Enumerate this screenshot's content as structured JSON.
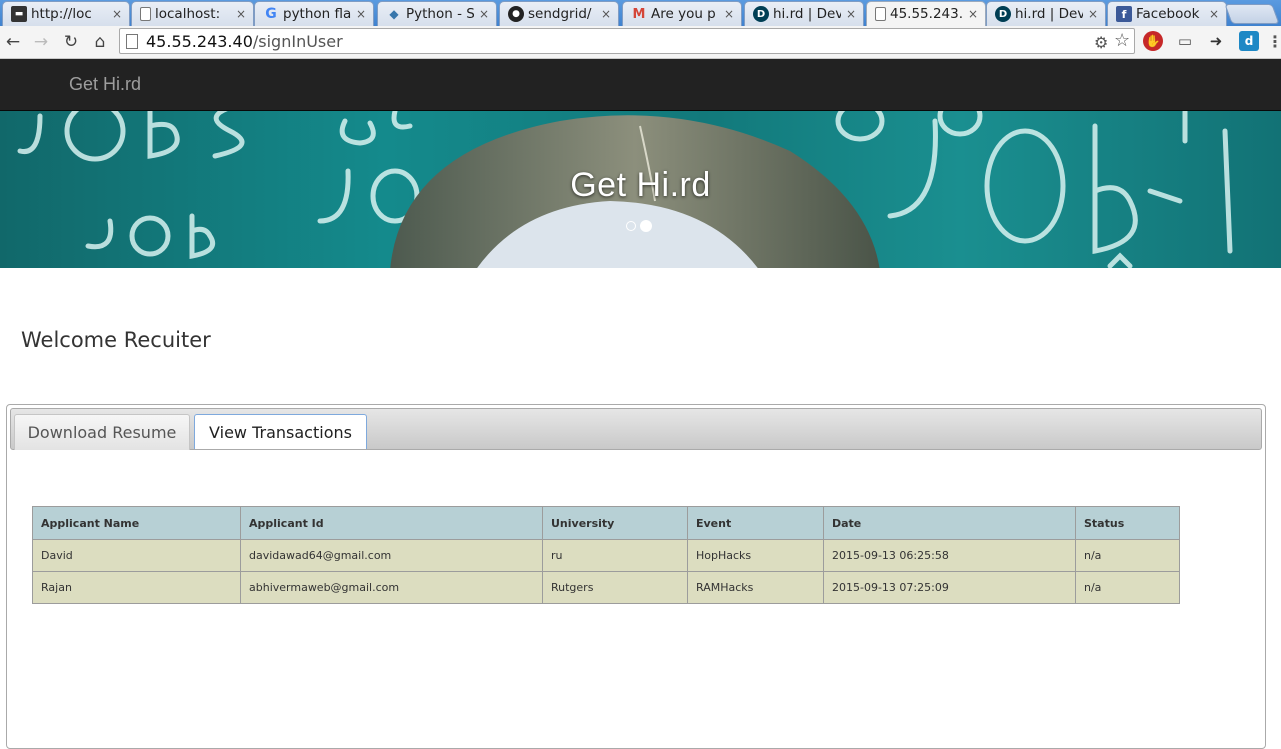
{
  "browser": {
    "tabs": [
      {
        "title": "http://loc",
        "icon": "terminal-icon"
      },
      {
        "title": "localhost:",
        "icon": "page-icon"
      },
      {
        "title": "python fla",
        "icon": "google-icon"
      },
      {
        "title": "Python - S",
        "icon": "python-icon"
      },
      {
        "title": "sendgrid/",
        "icon": "github-icon"
      },
      {
        "title": "Are you p",
        "icon": "gmail-icon"
      },
      {
        "title": "hi.rd | Dev",
        "icon": "devpost-icon"
      },
      {
        "title": "45.55.243.",
        "icon": "page-icon",
        "active": true
      },
      {
        "title": "hi.rd | Dev",
        "icon": "devpost-icon"
      },
      {
        "title": "Facebook",
        "icon": "facebook-icon"
      }
    ],
    "close_glyph": "×",
    "url_host": "45.55.243.40",
    "url_path": "/signInUser"
  },
  "navbar": {
    "brand": "Get Hi.rd"
  },
  "hero": {
    "title": "Get Hi.rd",
    "slide_count": 2,
    "active_slide": 2
  },
  "main": {
    "welcome": "Welcome Recuiter",
    "tabs": [
      {
        "label": "Download Resume",
        "active": false
      },
      {
        "label": "View Transactions",
        "active": true
      }
    ],
    "table": {
      "headers": [
        "Applicant Name",
        "Applicant Id",
        "University",
        "Event",
        "Date",
        "Status"
      ],
      "rows": [
        [
          "David",
          "davidawad64@gmail.com",
          "ru",
          "HopHacks",
          "2015-09-13 06:25:58",
          "n/a"
        ],
        [
          "Rajan",
          "abhivermaweb@gmail.com",
          "Rutgers",
          "RAMHacks",
          "2015-09-13 07:25:09",
          "n/a"
        ]
      ]
    }
  },
  "colors": {
    "navbar_bg": "#222222",
    "table_header_bg": "#b7d0d5",
    "table_row_bg": "#dcddc0",
    "chalkboard": "#148a8c"
  }
}
